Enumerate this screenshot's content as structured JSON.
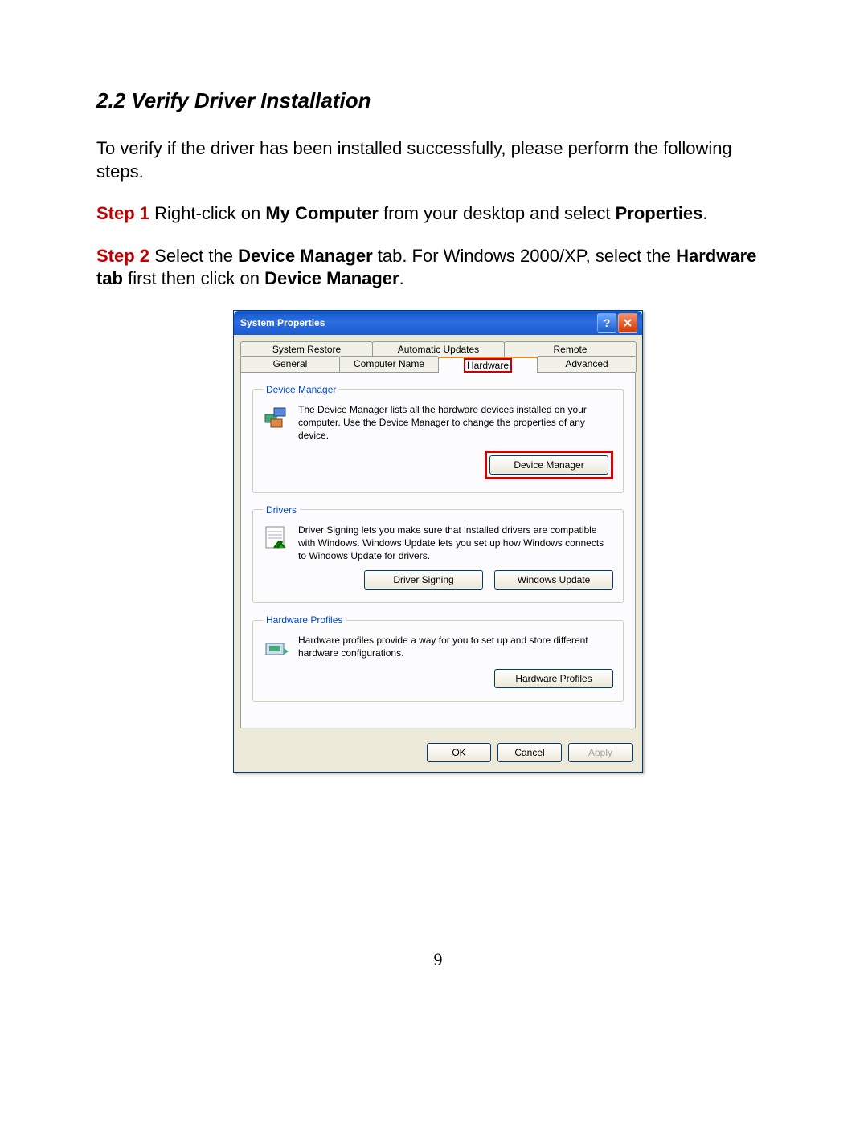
{
  "heading": "2.2 Verify Driver Installation",
  "intro": "To verify if the driver has been installed successfully, please perform the following steps.",
  "step1": {
    "label": "Step 1",
    "t1": " Right-click on ",
    "b1": "My Computer",
    "t2": " from your desktop and select ",
    "b2": "Properties",
    "t3": "."
  },
  "step2": {
    "label": "Step 2",
    "t1": " Select the ",
    "b1": "Device Manager",
    "t2": " tab. For Windows 2000/XP, select the ",
    "b2": "Hardware tab",
    "t3": " first then click on ",
    "b3": "Device Manager",
    "t4": "."
  },
  "dialog": {
    "title": "System Properties",
    "tabs_top": [
      "System Restore",
      "Automatic Updates",
      "Remote"
    ],
    "tabs_bottom": [
      "General",
      "Computer Name",
      "Hardware",
      "Advanced"
    ],
    "device_manager": {
      "legend": "Device Manager",
      "text": "The Device Manager lists all the hardware devices installed on your computer. Use the Device Manager to change the properties of any device.",
      "button": "Device Manager"
    },
    "drivers": {
      "legend": "Drivers",
      "text": "Driver Signing lets you make sure that installed drivers are compatible with Windows. Windows Update lets you set up how Windows connects to Windows Update for drivers.",
      "button1": "Driver Signing",
      "button2": "Windows Update"
    },
    "profiles": {
      "legend": "Hardware Profiles",
      "text": "Hardware profiles provide a way for you to set up and store different hardware configurations.",
      "button": "Hardware Profiles"
    },
    "footer": {
      "ok": "OK",
      "cancel": "Cancel",
      "apply": "Apply"
    }
  },
  "page_number": "9"
}
